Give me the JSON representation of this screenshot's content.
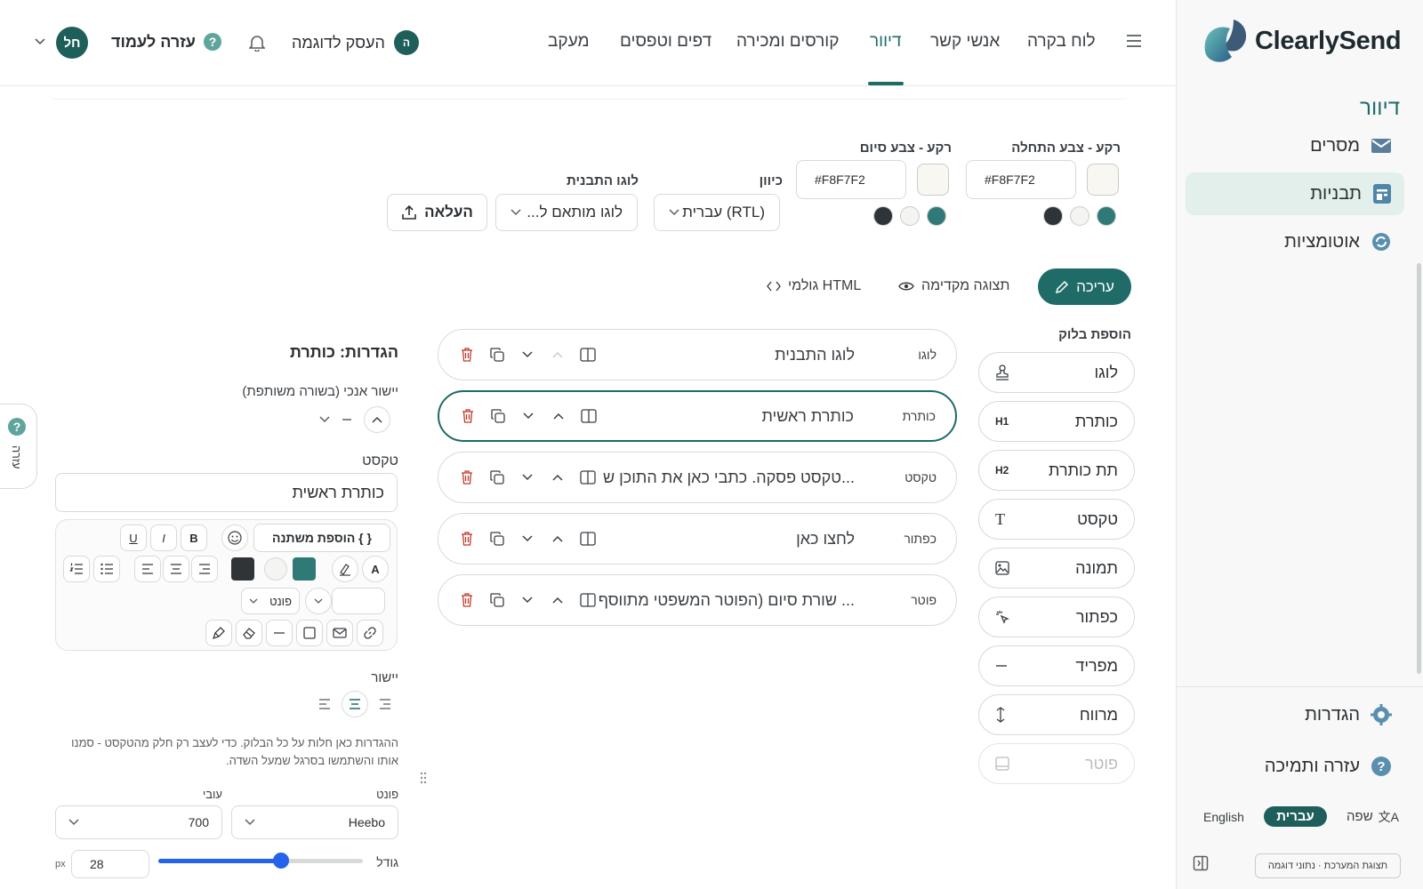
{
  "app": {
    "brand": "ClearlySend"
  },
  "sidebar": {
    "section_title": "דיוור",
    "items": [
      {
        "label": "מסרים",
        "icon": "envelope-icon"
      },
      {
        "label": "תבניות",
        "icon": "template-icon",
        "active": true
      },
      {
        "label": "אוטומציות",
        "icon": "refresh-icon"
      }
    ],
    "settings_label": "הגדרות",
    "help_label": "עזרה ותמיכה",
    "language_label": "שפה",
    "lang_he": "עברית",
    "lang_en": "English",
    "demo_note": "תצוגת המערכת · נתוני דוגמה"
  },
  "topnav": {
    "items": [
      "לוח בקרה",
      "אנשי קשר",
      "דיוור",
      "קורסים ומכירה",
      "דפים וטפסים",
      "מעקב"
    ],
    "active": "דיוור",
    "business_name": "העסק לדוגמה",
    "business_avatar": "ה",
    "help_label": "עזרה לעמוד",
    "user_avatar": "חל"
  },
  "template_settings": {
    "bg_start_label": "רקע - צבע התחלה",
    "bg_start_value": "#F8F7F2",
    "bg_end_label": "רקע - צבע סיום",
    "bg_end_value": "#F8F7F2",
    "direction_label": "כיוון",
    "direction_value": "עברית (RTL)",
    "logo_label": "לוגו התבנית",
    "logo_value": "לוגו מותאם ל...",
    "upload_label": "העלאה",
    "swatches": [
      "#2f7a76",
      "#f4f4f2",
      "#2f3438"
    ]
  },
  "mode_tabs": {
    "edit": "עריכה",
    "preview": "תצוגה מקדימה",
    "html": "HTML גולמי"
  },
  "palette": {
    "title": "הוספת בלוק",
    "items": [
      {
        "label": "לוגו",
        "icon": "stamp-icon"
      },
      {
        "label": "כותרת",
        "icon": "h1-icon"
      },
      {
        "label": "תת כותרת",
        "icon": "h2-icon"
      },
      {
        "label": "טקסט",
        "icon": "text-icon"
      },
      {
        "label": "תמונה",
        "icon": "image-icon"
      },
      {
        "label": "כפתור",
        "icon": "click-icon"
      },
      {
        "label": "מפריד",
        "icon": "minus-icon"
      },
      {
        "label": "מרווח",
        "icon": "vertical-arrows-icon"
      },
      {
        "label": "פוטר",
        "icon": "footer-icon",
        "disabled": true
      }
    ],
    "h1_glyph": "H1",
    "h2_glyph": "H2",
    "text_glyph": "T"
  },
  "blocks": [
    {
      "type": "לוגו",
      "text": "לוגו התבנית"
    },
    {
      "type": "כותרת",
      "text": "כותרת ראשית",
      "selected": true
    },
    {
      "type": "טקסט",
      "text": "טקסט פסקה. כתבי כאן את התוכן ש..."
    },
    {
      "type": "כפתור",
      "text": "לחצו כאן"
    },
    {
      "type": "פוטר",
      "text": "שורת סיום (הפוטר המשפטי מתווסף ..."
    }
  ],
  "block_settings": {
    "title": "הגדרות: כותרת",
    "valign_label": "יישור אנכי (בשורה משותפת)",
    "text_label": "טקסט",
    "text_value": "כותרת ראשית",
    "add_variable": "{ } הוספת משתנה",
    "font_dropdown": "פונט",
    "bold": "B",
    "italic": "I",
    "underline": "U",
    "font_color_glyph": "A",
    "align_label": "יישור",
    "help_text": "ההגדרות כאן חלות על כל הבלוק. כדי לעצב רק חלק מהטקסט - סמנו אותו והשתמשו בסרגל שמעל השדה.",
    "font_label": "פונט",
    "font_value": "Heebo",
    "weight_label": "עובי",
    "weight_value": "700",
    "size_label": "גודל",
    "size_value": "28",
    "size_unit": "px",
    "size_fraction": 0.6
  },
  "help_tab": {
    "label": "עזרה"
  },
  "colors": {
    "accent": "#1e6b68",
    "danger": "#c0392b"
  }
}
